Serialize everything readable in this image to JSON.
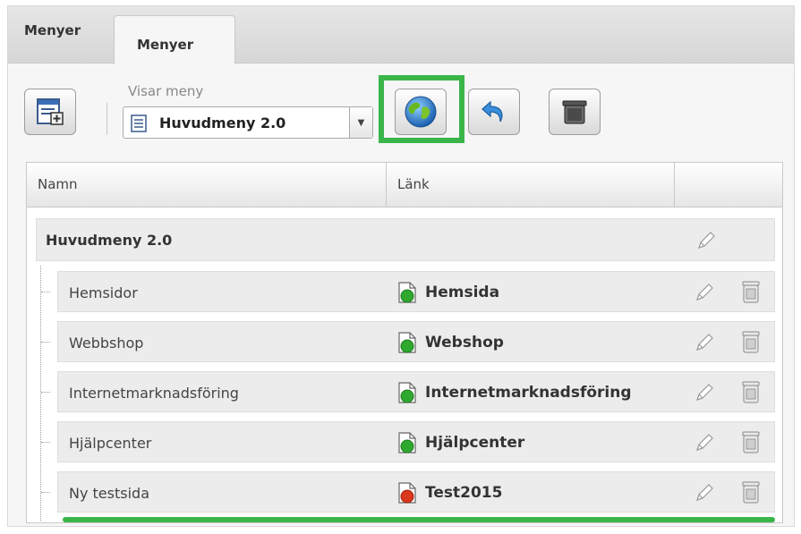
{
  "tabs": [
    {
      "label": "Menyer",
      "active": false
    },
    {
      "label": "Menyer",
      "active": true
    }
  ],
  "toolbar": {
    "new_menu_icon": "new-menu-icon",
    "label": "Visar meny",
    "selected_menu": "Huvudmeny 2.0",
    "publish_icon": "globe-icon",
    "undo_icon": "undo-icon",
    "delete_icon": "trash-icon"
  },
  "grid": {
    "columns": [
      "Namn",
      "Länk",
      ""
    ],
    "root": {
      "name": "Huvudmeny 2.0"
    },
    "rows": [
      {
        "name": "Hemsidor",
        "link": "Hemsida",
        "status_color": "#2fa82f"
      },
      {
        "name": "Webbshop",
        "link": "Webshop",
        "status_color": "#2fa82f"
      },
      {
        "name": "Internetmarknadsföring",
        "link": "Internetmarknadsföring",
        "status_color": "#2fa82f"
      },
      {
        "name": "Hjälpcenter",
        "link": "Hjälpcenter",
        "status_color": "#2fa82f"
      },
      {
        "name": "Ny testsida",
        "link": "Test2015",
        "status_color": "#d9381e"
      }
    ]
  },
  "colors": {
    "highlight": "#3ab54a",
    "status_published": "#2fa82f",
    "status_unpublished": "#d9381e"
  }
}
